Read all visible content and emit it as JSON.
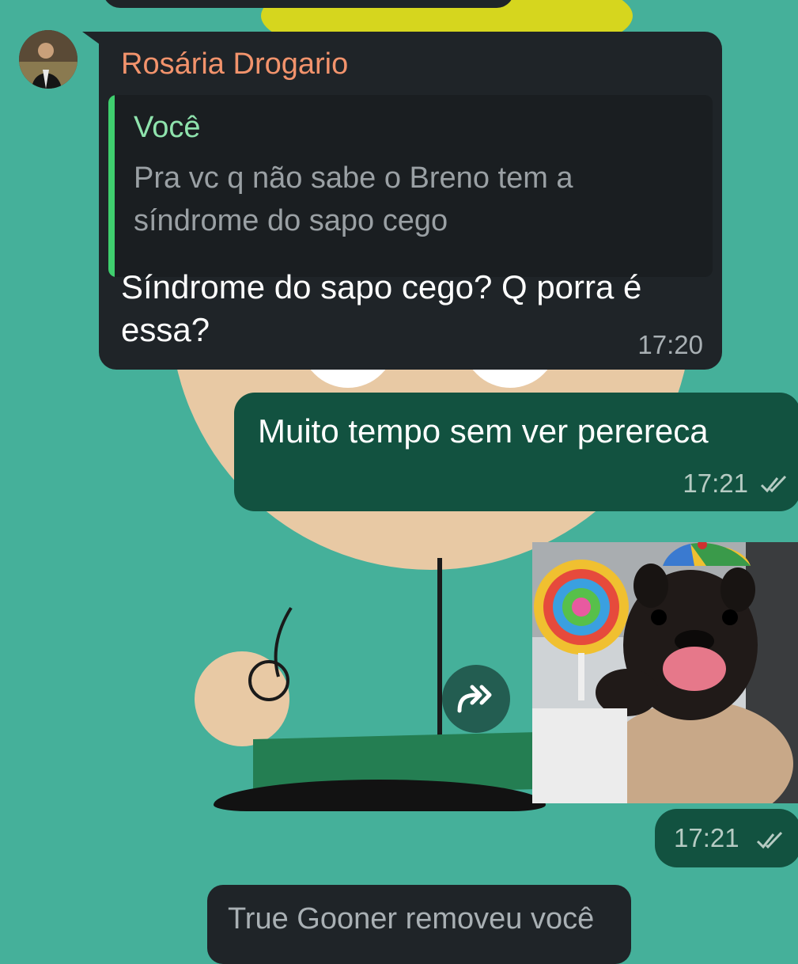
{
  "chat": {
    "incoming": {
      "sender": "Rosária Drogario",
      "quote_author": "Você",
      "quote_text": "Pra vc q não sabe o Breno tem a síndrome do sapo cego",
      "text": "Síndrome do sapo cego? Q porra é essa?",
      "time": "17:20"
    },
    "outgoing": {
      "text": "Muito tempo sem ver perereca",
      "time": "17:21"
    },
    "sticker_time": "17:21",
    "system_message": "True Gooner removeu você"
  },
  "colors": {
    "wallpaper": "#45b09a",
    "incoming_bubble": "#1f2428",
    "outgoing_bubble": "#125240",
    "sender_name": "#f2936c",
    "quote_bar": "#3fcf6e"
  },
  "icons": [
    "avatar",
    "double-check-icon",
    "forward-icon",
    "sticker-image"
  ]
}
